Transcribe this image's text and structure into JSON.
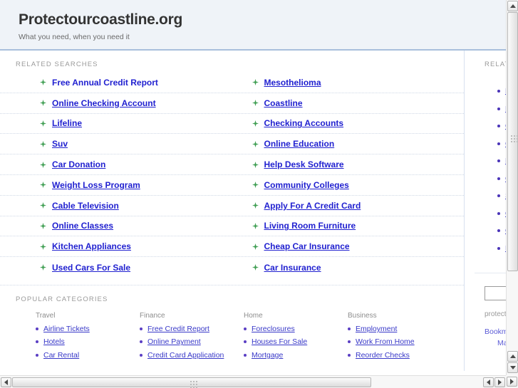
{
  "header": {
    "title": "Protectourcoastline.org",
    "tagline": "What you need, when you need it"
  },
  "main": {
    "related_searches_label": "RELATED SEARCHES",
    "popular_categories_label": "POPULAR CATEGORIES",
    "related_searches": [
      {
        "left": "Free Annual Credit Report",
        "left_hover": true,
        "right": "Mesothelioma"
      },
      {
        "left": "Online Checking Account",
        "left_hover": false,
        "right": "Coastline"
      },
      {
        "left": "Lifeline",
        "left_hover": false,
        "right": "Checking Accounts"
      },
      {
        "left": "Suv",
        "left_hover": false,
        "right": "Online Education"
      },
      {
        "left": "Car Donation",
        "left_hover": false,
        "right": "Help Desk Software"
      },
      {
        "left": "Weight Loss Program",
        "left_hover": false,
        "right": "Community Colleges"
      },
      {
        "left": "Cable Television",
        "left_hover": false,
        "right": "Apply For A Credit Card"
      },
      {
        "left": "Online Classes",
        "left_hover": false,
        "right": "Living Room Furniture"
      },
      {
        "left": "Kitchen Appliances",
        "left_hover": false,
        "right": "Cheap Car Insurance"
      },
      {
        "left": "Used Cars For Sale",
        "left_hover": false,
        "right": "Car Insurance"
      }
    ],
    "popular_categories": [
      {
        "heading": "Travel",
        "items": [
          "Airline Tickets",
          "Hotels",
          "Car Rental"
        ]
      },
      {
        "heading": "Finance",
        "items": [
          "Free Credit Report",
          "Online Payment",
          "Credit Card Application"
        ]
      },
      {
        "heading": "Home",
        "items": [
          "Foreclosures",
          "Houses For Sale",
          "Mortgage"
        ]
      },
      {
        "heading": "Business",
        "items": [
          "Employment",
          "Work From Home",
          "Reorder Checks"
        ]
      }
    ]
  },
  "sidebar": {
    "label": "RELATED SEARCHES",
    "items": [
      "Free Annual Credit Report",
      "Mesothelioma",
      "Online Checking Account",
      "Coastline",
      "Lifeline",
      "Checking Accounts",
      "Suv",
      "Online Education",
      "Car Donation",
      "Help Desk Software"
    ],
    "search_value": "",
    "search_placeholder": "",
    "domain_text": "protectourcoastline.org",
    "bookmark_label": "Bookmark this page",
    "homepage_label": "Make this my homepage"
  },
  "colors": {
    "header_bg": "#eff3f8",
    "header_rule": "#a8bfdc",
    "link_blue": "#2121d0",
    "bullet_green": "#3f9e52",
    "label_gray": "#9a9a9a"
  },
  "scrollbars": {
    "vertical": {
      "up_icon": "triangle-up-icon",
      "down_icon": "triangle-down-icon"
    },
    "horizontal": {
      "left_icon": "triangle-left-icon",
      "right_icon": "triangle-right-icon"
    }
  }
}
